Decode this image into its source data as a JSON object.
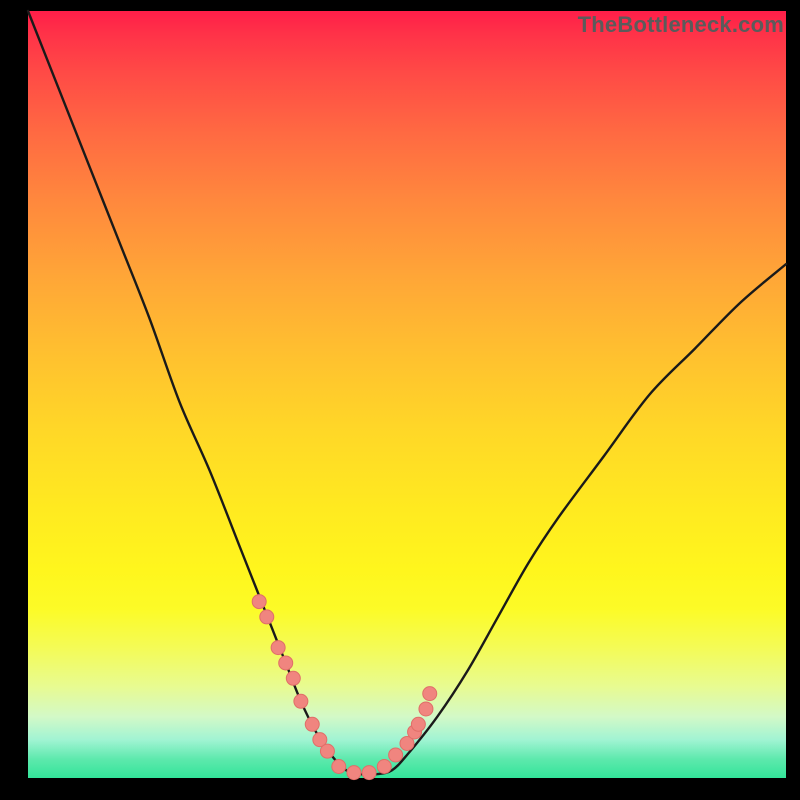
{
  "watermark": "TheBottleneck.com",
  "colors": {
    "curve_stroke": "#1a1a1a",
    "marker_fill": "#f0857f",
    "marker_stroke": "#e06e68"
  },
  "chart_data": {
    "type": "line",
    "title": "",
    "xlabel": "",
    "ylabel": "",
    "xlim": [
      0,
      100
    ],
    "ylim": [
      0,
      100
    ],
    "note": "Axes have no visible tick labels; x/y are estimated as 0–100 percent ranges.",
    "series": [
      {
        "name": "bottleneck-curve",
        "x": [
          0,
          4,
          8,
          12,
          16,
          20,
          24,
          28,
          30,
          32,
          34,
          36,
          38,
          40,
          42,
          44,
          46,
          48,
          50,
          54,
          58,
          62,
          66,
          70,
          76,
          82,
          88,
          94,
          100
        ],
        "y": [
          100,
          90,
          80,
          70,
          60,
          49,
          40,
          30,
          25,
          20,
          15,
          10,
          6,
          3,
          1,
          0.5,
          0.5,
          1,
          3,
          8,
          14,
          21,
          28,
          34,
          42,
          50,
          56,
          62,
          67
        ]
      }
    ],
    "markers": {
      "name": "sample-points",
      "x": [
        30.5,
        31.5,
        33.0,
        34.0,
        35.0,
        36.0,
        37.5,
        38.5,
        39.5,
        41.0,
        43.0,
        45.0,
        47.0,
        48.5,
        50.0,
        51.0,
        51.5,
        52.5,
        53.0
      ],
      "y": [
        23,
        21,
        17,
        15,
        13,
        10,
        7,
        5,
        3.5,
        1.5,
        0.7,
        0.7,
        1.5,
        3,
        4.5,
        6,
        7,
        9,
        11
      ]
    }
  }
}
